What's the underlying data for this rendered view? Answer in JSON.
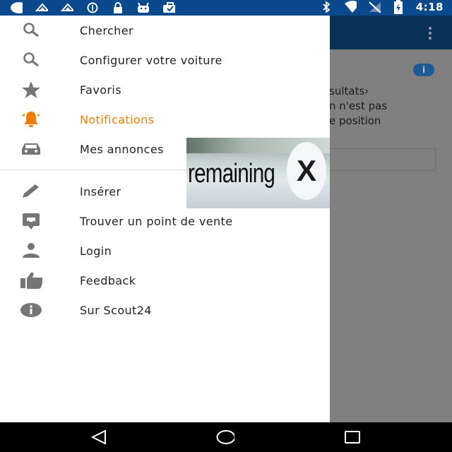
{
  "status_bar": {
    "time": "4:18",
    "left_icons": [
      "circle-icon",
      "wifi-cast-icon",
      "wifi-cast-icon",
      "data-saver-icon",
      "lock-icon",
      "android-icon",
      "briefcase-icon"
    ],
    "right_icons": [
      "bluetooth-icon",
      "wifi-icon",
      "no-sim-icon",
      "battery-charging-icon"
    ]
  },
  "background": {
    "text_lines": [
      "sultats›",
      "n n'est pas",
      "e position"
    ],
    "info_label": "i"
  },
  "drawer": {
    "items_primary": [
      {
        "label": "Chercher",
        "icon": "search-icon"
      },
      {
        "label": "Configurer votre voiture",
        "icon": "search-icon"
      },
      {
        "label": "Favoris",
        "icon": "star-icon"
      },
      {
        "label": "Notifications",
        "icon": "bell-icon",
        "active": true
      },
      {
        "label": "Mes annonces",
        "icon": "car-icon"
      }
    ],
    "items_secondary": [
      {
        "label": "Insérer",
        "icon": "pencil-icon"
      },
      {
        "label": "Trouver un point de vente",
        "icon": "dealer-icon"
      },
      {
        "label": "Login",
        "icon": "person-icon"
      },
      {
        "label": "Feedback",
        "icon": "thumbs-up-icon"
      },
      {
        "label": "Sur Scout24",
        "icon": "info-icon"
      }
    ]
  },
  "ad": {
    "text": "remaining",
    "close_label": "X"
  },
  "colors": {
    "accent": "#f07d00",
    "toolbar": "#0a3156",
    "status_bar": "#0a4a8c",
    "icon_gray": "#757575"
  }
}
